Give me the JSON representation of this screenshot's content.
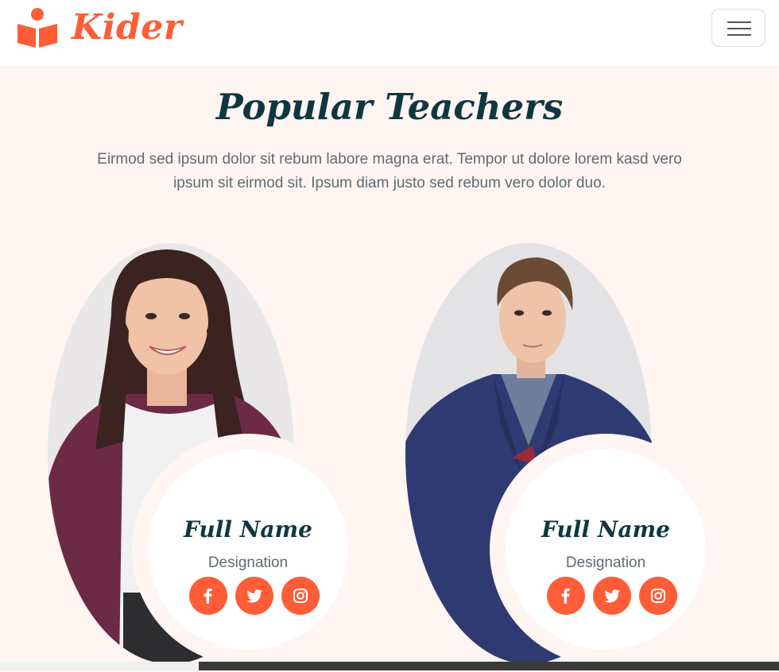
{
  "brand": {
    "name": "Kider",
    "icon": "book-reader-icon",
    "color": "#fe5d37"
  },
  "nav": {
    "menu_icon": "hamburger-menu-icon"
  },
  "section": {
    "title": "Popular Teachers",
    "description": "Eirmod sed ipsum dolor sit rebum labore magna erat. Tempor ut dolore lorem kasd vero ipsum sit eirmod sit. Ipsum diam justo sed rebum vero dolor duo."
  },
  "teachers": [
    {
      "name": "Full Name",
      "designation": "Designation",
      "photo": "woman-teacher-photo",
      "socials": [
        "facebook-icon",
        "twitter-icon",
        "instagram-icon"
      ]
    },
    {
      "name": "Full Name",
      "designation": "Designation",
      "photo": "man-teacher-photo",
      "socials": [
        "facebook-icon",
        "twitter-icon",
        "instagram-icon"
      ]
    }
  ],
  "colors": {
    "accent": "#fe5d37",
    "heading": "#103741",
    "body_bg": "#fff5f3",
    "text": "#5f6a70"
  }
}
